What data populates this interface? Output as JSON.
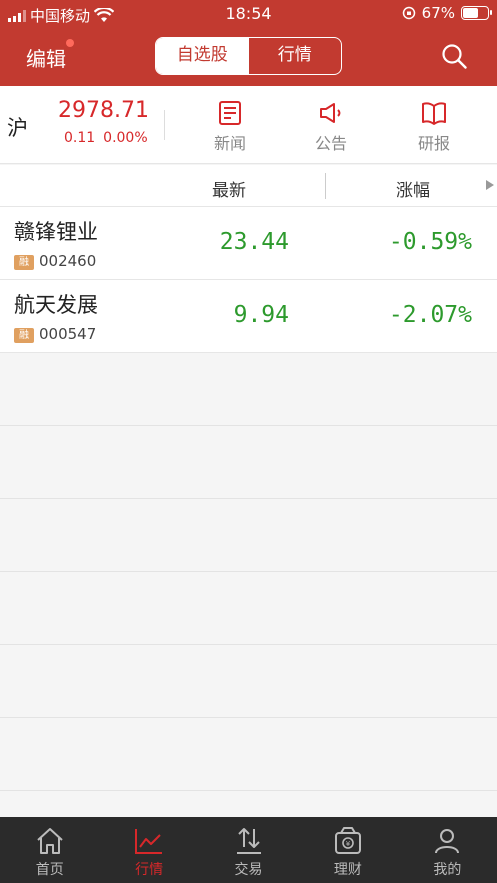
{
  "status": {
    "carrier": "中国移动",
    "time": "18:54",
    "battery_text": "67%",
    "battery_level": 0.67
  },
  "nav": {
    "edit_label": "编辑",
    "tabs": [
      {
        "label": "自选股",
        "active": true
      },
      {
        "label": "行情",
        "active": false
      }
    ]
  },
  "index": {
    "name": "沪",
    "value": "2978.71",
    "change": "0.11",
    "change_pct": "0.00%"
  },
  "quick_links": [
    {
      "label": "新闻",
      "icon": "news-icon"
    },
    {
      "label": "公告",
      "icon": "announcement-icon"
    },
    {
      "label": "研报",
      "icon": "research-report-icon"
    }
  ],
  "columns": {
    "latest": "最新",
    "change": "涨幅"
  },
  "stocks": [
    {
      "name": "赣锋锂业",
      "tag": "融",
      "code": "002460",
      "price": "23.44",
      "pct": "-0.59%"
    },
    {
      "name": "航天发展",
      "tag": "融",
      "code": "000547",
      "price": "9.94",
      "pct": "-2.07%"
    }
  ],
  "tabbar": [
    {
      "label": "首页",
      "icon": "home-icon",
      "active": false
    },
    {
      "label": "行情",
      "icon": "market-chart-icon",
      "active": true
    },
    {
      "label": "交易",
      "icon": "trade-icon",
      "active": false
    },
    {
      "label": "理财",
      "icon": "wealth-icon",
      "active": false
    },
    {
      "label": "我的",
      "icon": "profile-icon",
      "active": false
    }
  ],
  "colors": {
    "brand_red": "#c23a30",
    "up_red": "#d7282a",
    "down_green": "#2d9a2d"
  }
}
